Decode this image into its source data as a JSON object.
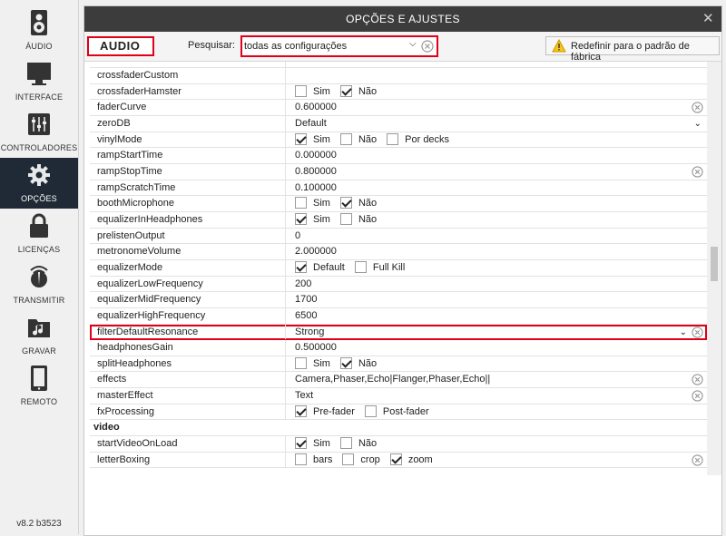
{
  "sidebar": {
    "items": [
      {
        "label": "ÁUDIO",
        "icon": "speaker-icon"
      },
      {
        "label": "INTERFACE",
        "icon": "monitor-icon"
      },
      {
        "label": "CONTROLADORES",
        "icon": "mixer-icon"
      },
      {
        "label": "OPÇÕES",
        "icon": "gear-icon"
      },
      {
        "label": "LICENÇAS",
        "icon": "lock-icon"
      },
      {
        "label": "TRANSMITIR",
        "icon": "broadcast-icon"
      },
      {
        "label": "GRAVAR",
        "icon": "music-folder-icon"
      },
      {
        "label": "REMOTO",
        "icon": "tablet-icon"
      }
    ],
    "active": 3,
    "version": "v8.2 b3523"
  },
  "window": {
    "title": "OPÇÕES E AJUSTES",
    "close": "✕"
  },
  "toolbar": {
    "category": "AUDIO",
    "search_label": "Pesquisar:",
    "search_value": "todas as configurações",
    "reset_label": "Redefinir para o padrão de fábrica"
  },
  "rows": [
    {
      "key": "crossfaderCustom",
      "value": ""
    },
    {
      "key": "crossfaderHamster",
      "opts": [
        {
          "l": "Sim",
          "c": false
        },
        {
          "l": "Não",
          "c": true
        }
      ]
    },
    {
      "key": "faderCurve",
      "value": "0.600000",
      "clear": true
    },
    {
      "key": "zeroDB",
      "value": "Default",
      "dropdown": true
    },
    {
      "key": "vinylMode",
      "opts": [
        {
          "l": "Sim",
          "c": true
        },
        {
          "l": "Não",
          "c": false
        },
        {
          "l": "Por decks",
          "c": false
        }
      ]
    },
    {
      "key": "rampStartTime",
      "value": "0.000000"
    },
    {
      "key": "rampStopTime",
      "value": "0.800000",
      "clear": true
    },
    {
      "key": "rampScratchTime",
      "value": "0.100000"
    },
    {
      "key": "boothMicrophone",
      "opts": [
        {
          "l": "Sim",
          "c": false
        },
        {
          "l": "Não",
          "c": true
        }
      ]
    },
    {
      "key": "equalizerInHeadphones",
      "opts": [
        {
          "l": "Sim",
          "c": true
        },
        {
          "l": "Não",
          "c": false
        }
      ]
    },
    {
      "key": "prelistenOutput",
      "value": "0"
    },
    {
      "key": "metronomeVolume",
      "value": "2.000000"
    },
    {
      "key": "equalizerMode",
      "opts": [
        {
          "l": "Default",
          "c": true
        },
        {
          "l": "Full Kill",
          "c": false
        }
      ]
    },
    {
      "key": "equalizerLowFrequency",
      "value": "200"
    },
    {
      "key": "equalizerMidFrequency",
      "value": "1700"
    },
    {
      "key": "equalizerHighFrequency",
      "value": "6500"
    },
    {
      "key": "filterDefaultResonance",
      "value": "Strong",
      "dropdown": true,
      "clear": true,
      "highlight": true
    },
    {
      "key": "headphonesGain",
      "value": "0.500000"
    },
    {
      "key": "splitHeadphones",
      "opts": [
        {
          "l": "Sim",
          "c": false
        },
        {
          "l": "Não",
          "c": true
        }
      ]
    },
    {
      "key": "effects",
      "value": "Camera,Phaser,Echo|Flanger,Phaser,Echo||",
      "clear": true
    },
    {
      "key": "masterEffect",
      "value": "Text",
      "clear": true
    },
    {
      "key": "fxProcessing",
      "opts": [
        {
          "l": "Pre-fader",
          "c": true
        },
        {
          "l": "Post-fader",
          "c": false
        }
      ]
    },
    {
      "key": "video",
      "section": true
    },
    {
      "key": "startVideoOnLoad",
      "opts": [
        {
          "l": "Sim",
          "c": true
        },
        {
          "l": "Não",
          "c": false
        }
      ]
    },
    {
      "key": "letterBoxing",
      "opts": [
        {
          "l": "bars",
          "c": false
        },
        {
          "l": "crop",
          "c": false
        },
        {
          "l": "zoom",
          "c": true
        }
      ],
      "clear": true
    }
  ],
  "colors": {
    "highlight": "#e0001a",
    "titlebar": "#3c3c3c",
    "sidebar_active": "#1f2a36"
  }
}
